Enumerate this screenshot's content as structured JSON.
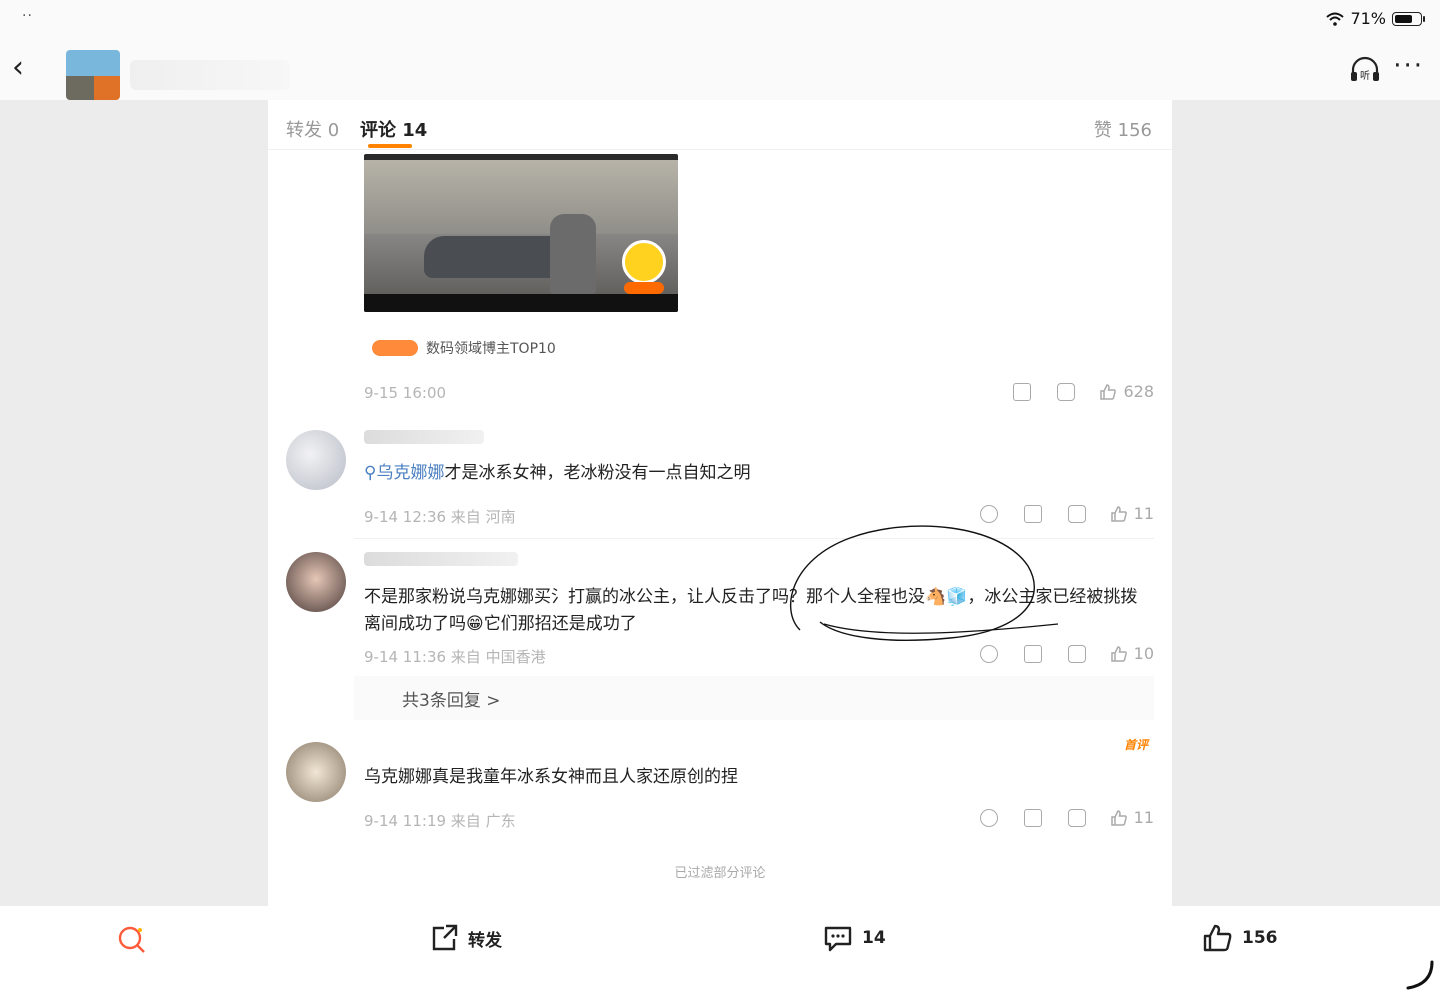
{
  "status_bar": {
    "battery": "71%"
  },
  "tabs": {
    "repost": "转发 0",
    "comment": "评论 14",
    "like": "赞 156"
  },
  "post": {
    "top10": "数码领域博主TOP10",
    "timestamp": "9-15 16:00",
    "like_count": "628"
  },
  "comments": [
    {
      "mention": "乌克娜娜",
      "text": "才是冰系女神，老冰粉没有一点自知之明",
      "meta": "9-14 12:36 来自 河南",
      "likes": "11"
    },
    {
      "text": "不是那家粉说乌克娜娜买氵打赢的冰公主，让人反击了吗？那个人全程也没🐴🧊，冰公主家已经被挑拨离间成功了吗😁它们那招还是成功了",
      "meta": "9-14 11:36 来自 中国香港",
      "likes": "10",
      "replies": "共3条回复 >"
    },
    {
      "tag": "首评",
      "text": "乌克娜娜真是我童年冰系女神而且人家还原创的捏",
      "meta": "9-14 11:19 来自 广东",
      "likes": "11"
    }
  ],
  "filtered_notice": "已过滤部分评论",
  "bottom_bar": {
    "repost": "转发",
    "comment": "14",
    "like": "156"
  },
  "colors": {
    "accent": "#ff8200",
    "mention": "#4a7fc1"
  }
}
